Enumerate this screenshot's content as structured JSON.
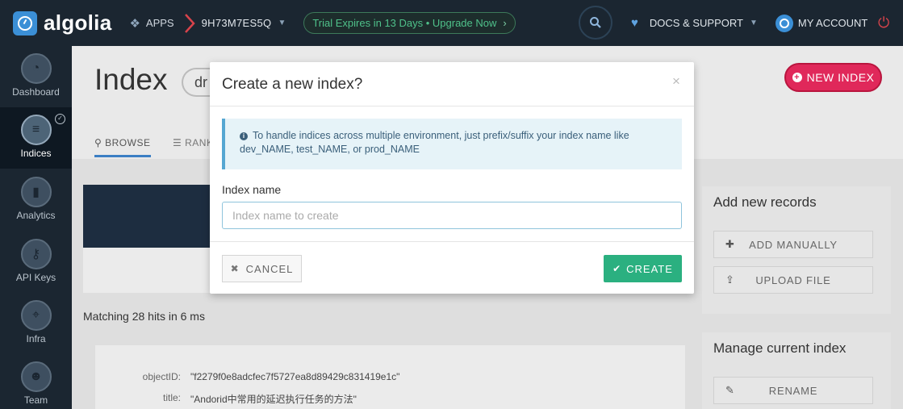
{
  "brand": {
    "name": "algolia"
  },
  "topbar": {
    "apps_label": "APPS",
    "app_id": "9H73M7ES5Q",
    "trial_text": "Trial Expires in 13 Days • Upgrade Now",
    "docs_label": "DOCS & SUPPORT",
    "account_label": "MY ACCOUNT"
  },
  "sidebar": {
    "items": [
      {
        "label": "Dashboard",
        "icon": "gauge-icon"
      },
      {
        "label": "Indices",
        "icon": "database-icon"
      },
      {
        "label": "Analytics",
        "icon": "bar-chart-icon"
      },
      {
        "label": "API Keys",
        "icon": "key-icon"
      },
      {
        "label": "Infra",
        "icon": "map-pin-icon"
      },
      {
        "label": "Team",
        "icon": "users-icon"
      }
    ]
  },
  "page": {
    "title": "Index",
    "index_name_partial": "dr",
    "new_index_label": "NEW INDEX",
    "tabs": [
      {
        "label": "BROWSE"
      },
      {
        "label": "RANK"
      }
    ],
    "hits_text": "Matching 28 hits in 6 ms",
    "record": [
      {
        "key": "objectID:",
        "value": "\"f2279f0e8adcfec7f5727ea8d89429c831419e1c\""
      },
      {
        "key": "title:",
        "value": "\"Andorid中常用的延迟执行任务的方法\""
      }
    ]
  },
  "panels": {
    "add_records": {
      "title": "Add new records",
      "buttons": [
        {
          "label": "ADD MANUALLY"
        },
        {
          "label": "UPLOAD FILE"
        }
      ]
    },
    "manage": {
      "title": "Manage current index",
      "buttons": [
        {
          "label": "RENAME"
        }
      ]
    }
  },
  "modal": {
    "title": "Create a new index?",
    "close_glyph": "×",
    "info_text": "To handle indices across multiple environment, just prefix/suffix your index name like dev_NAME, test_NAME, or prod_NAME",
    "field_label": "Index name",
    "field_placeholder": "Index name to create",
    "field_value": "",
    "cancel_label": "CANCEL",
    "create_label": "CREATE"
  },
  "colors": {
    "topbar_bg": "#1b2631",
    "accent_blue": "#3b8fd6",
    "new_index_pink": "#e0285a",
    "create_green": "#2bb080",
    "trial_green": "#4fc18a"
  }
}
